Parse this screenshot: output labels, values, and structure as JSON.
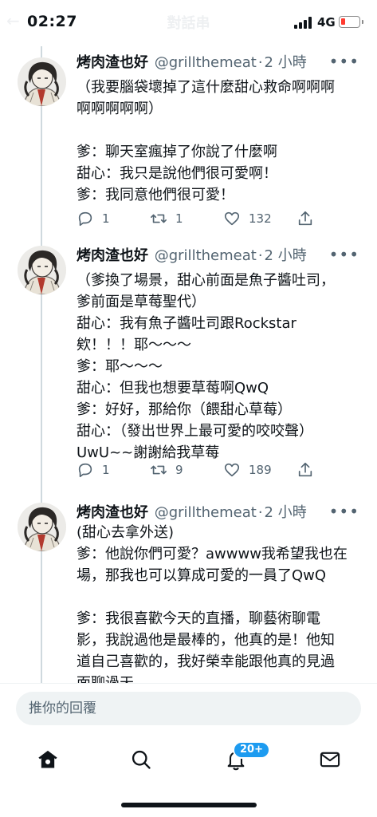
{
  "status_bar": {
    "time": "02:27",
    "network": "4G"
  },
  "header": {
    "title": "對話串"
  },
  "tweets": [
    {
      "name": "烤肉渣也好",
      "handle": "@grillthemeat",
      "separator": "·",
      "time": "2 小時",
      "more": "•••",
      "lines": [
        "（我要腦袋壞掉了這什麼甜心救命啊啊啊",
        "啊啊啊啊啊）",
        "",
        "爹：聊天室瘋掉了你說了什麼啊",
        "甜心：我只是說他們很可愛啊！",
        "爹：我同意他們很可愛！"
      ],
      "replies": "1",
      "retweets": "1",
      "likes": "132"
    },
    {
      "name": "烤肉渣也好",
      "handle": "@grillthemeat",
      "separator": "·",
      "time": "2 小時",
      "more": "•••",
      "lines": [
        "（爹換了場景，甜心前面是魚子醬吐司，",
        "爹前面是草莓聖代）",
        "甜心：我有魚子醬吐司跟Rockstar",
        "欸！！！耶～～～",
        "爹：耶～～～",
        "甜心：但我也想要草莓啊QwQ",
        "爹：好好，那給你（餵甜心草莓）",
        "甜心：（發出世界上最可愛的咬咬聲）",
        "UwU~~謝謝給我草莓"
      ],
      "replies": "1",
      "retweets": "9",
      "likes": "189"
    },
    {
      "name": "烤肉渣也好",
      "handle": "@grillthemeat",
      "separator": "·",
      "time": "2 小時",
      "more": "•••",
      "lines": [
        "(甜心去拿外送)",
        "爹：他說你們可愛？awwww我希望我也在",
        "場，那我也可以算成可愛的一員了QwQ",
        "",
        "爹：我很喜歡今天的直播，聊藝術聊電",
        "影，我說過他是最棒的，他真的是！他知",
        "道自己喜歡的，我好榮幸能跟他真的見過",
        "面聊過天"
      ]
    }
  ],
  "reply_box": {
    "placeholder": "推你的回覆"
  },
  "nav": {
    "notification_badge": "20+"
  },
  "colors": {
    "accent": "#1d9bf0",
    "text": "#0f1419",
    "muted": "#536471",
    "thread_line": "#cfd9de"
  },
  "icons": [
    "signal-icon",
    "battery-icon",
    "more-icon",
    "reply-icon",
    "retweet-icon",
    "like-icon",
    "share-icon",
    "home-icon",
    "search-icon",
    "notifications-icon",
    "messages-icon"
  ]
}
